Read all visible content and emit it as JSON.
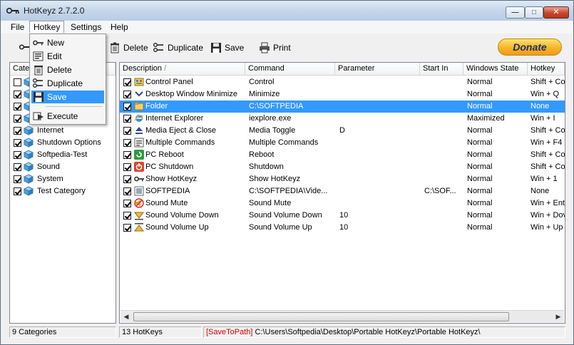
{
  "window": {
    "title": "HotKeyz 2.7.2.0"
  },
  "menubar": {
    "items": [
      "File",
      "Hotkey",
      "Settings",
      "Help"
    ]
  },
  "hotkey_menu": {
    "items": [
      {
        "label": "New",
        "icon": "key-icon"
      },
      {
        "label": "Edit",
        "icon": "edit-icon"
      },
      {
        "label": "Delete",
        "icon": "trash-icon"
      },
      {
        "label": "Duplicate",
        "icon": "duplicate-icon"
      },
      {
        "label": "Save",
        "icon": "floppy-icon",
        "highlighted": true
      },
      {
        "label": "Execute",
        "icon": "execute-icon"
      }
    ]
  },
  "toolbar": {
    "delete_label": "Delete",
    "duplicate_label": "Duplicate",
    "save_label": "Save",
    "print_label": "Print",
    "donate_label": "Donate"
  },
  "categories": {
    "header": "Cate",
    "items": [
      {
        "label": "",
        "checked": false
      },
      {
        "label": "",
        "checked": true
      },
      {
        "label": "",
        "checked": true
      },
      {
        "label": "",
        "checked": true
      },
      {
        "label": "Internet",
        "checked": true
      },
      {
        "label": "Shutdown Options",
        "checked": true
      },
      {
        "label": "Softpedia-Test",
        "checked": true
      },
      {
        "label": "Sound",
        "checked": true
      },
      {
        "label": "System",
        "checked": true
      },
      {
        "label": "Test Category",
        "checked": true
      }
    ]
  },
  "hotkeys_table": {
    "columns": [
      "Description",
      "Command",
      "Parameter",
      "Start In",
      "Windows State",
      "Hotkey"
    ],
    "sort_indicator": "/",
    "rows": [
      {
        "description": "Control Panel",
        "command": "Control",
        "parameter": "",
        "start_in": "",
        "state": "Normal",
        "hotkey": "Shift + Cor",
        "icon": "control-panel-icon",
        "selected": false
      },
      {
        "description": "Desktop Window Minimize",
        "command": "Minimize",
        "parameter": "",
        "start_in": "",
        "state": "Normal",
        "hotkey": "Win + Q",
        "icon": "minimize-icon",
        "selected": false
      },
      {
        "description": "Folder",
        "command": "C:\\SOFTPEDIA",
        "parameter": "",
        "start_in": "",
        "state": "Normal",
        "hotkey": "None",
        "icon": "folder-icon",
        "selected": true
      },
      {
        "description": "Internet Explorer",
        "command": "iexplore.exe",
        "parameter": "",
        "start_in": "",
        "state": "Maximized",
        "hotkey": "Win + I",
        "icon": "ie-icon",
        "selected": false
      },
      {
        "description": "Media Eject & Close",
        "command": "Media Toggle",
        "parameter": "D",
        "start_in": "",
        "state": "Normal",
        "hotkey": "Shift + Cor",
        "icon": "eject-icon",
        "selected": false
      },
      {
        "description": "Multiple Commands",
        "command": "Multiple Commands",
        "parameter": "",
        "start_in": "",
        "state": "Normal",
        "hotkey": "Win + F4",
        "icon": "multi-command-icon",
        "selected": false
      },
      {
        "description": "PC Reboot",
        "command": "Reboot",
        "parameter": "",
        "start_in": "",
        "state": "Normal",
        "hotkey": "Shift + Cor",
        "icon": "reboot-icon",
        "selected": false
      },
      {
        "description": "PC Shutdown",
        "command": "Shutdown",
        "parameter": "",
        "start_in": "",
        "state": "Normal",
        "hotkey": "Shift + Cor",
        "icon": "shutdown-icon",
        "selected": false
      },
      {
        "description": "Show HotKeyz",
        "command": "Show HotKeyz",
        "parameter": "",
        "start_in": "",
        "state": "Normal",
        "hotkey": "Win + 1",
        "icon": "key-icon",
        "selected": false
      },
      {
        "description": "SOFTPEDIA",
        "command": "C:\\SOFTPEDIA\\Vide...",
        "parameter": "",
        "start_in": "C:\\SOF...",
        "state": "Normal",
        "hotkey": "None",
        "icon": "video-icon",
        "selected": false
      },
      {
        "description": "Sound Mute",
        "command": "Sound Mute",
        "parameter": "",
        "start_in": "",
        "state": "Normal",
        "hotkey": "Win + Ent",
        "icon": "mute-icon",
        "selected": false
      },
      {
        "description": "Sound Volume Down",
        "command": "Sound Volume Down",
        "parameter": "10",
        "start_in": "",
        "state": "Normal",
        "hotkey": "Win + Dov",
        "icon": "volume-down-icon",
        "selected": false
      },
      {
        "description": "Sound Volume Up",
        "command": "Sound Volume Up",
        "parameter": "10",
        "start_in": "",
        "state": "Normal",
        "hotkey": "Win + Up",
        "icon": "volume-up-icon",
        "selected": false
      }
    ]
  },
  "statusbar": {
    "categories_count": "9 Categories",
    "hotkeys_count": "13 HotKeys",
    "path_tag": "[SaveToPath]",
    "path": "C:\\Users\\Softpedia\\Desktop\\Portable HotKeyz\\Portable HotKeyz\\"
  },
  "colors": {
    "selection": "#3399ff",
    "path_tag": "#d40000",
    "donate": "#f7b52b"
  }
}
